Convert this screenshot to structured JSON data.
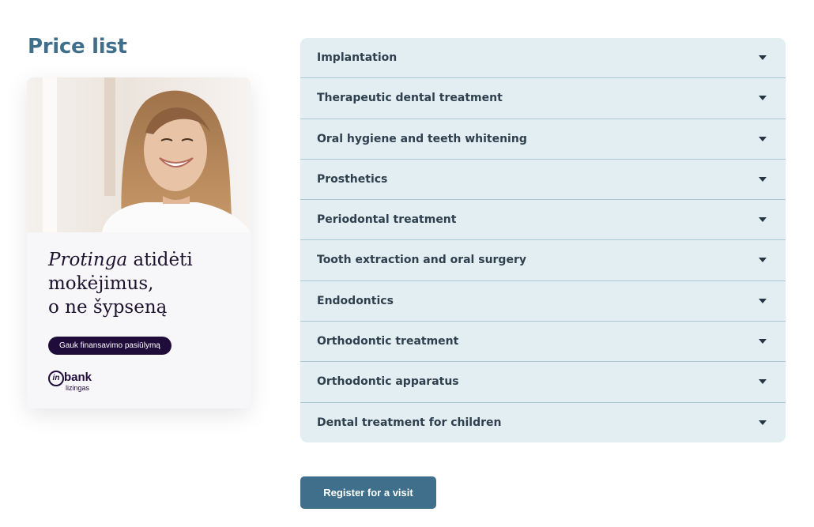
{
  "page": {
    "title": "Price list"
  },
  "promo": {
    "headline_em": "Protinga",
    "headline_rest_line1": " atidėti",
    "headline_line2": "mokėjimus,",
    "headline_line3": "o ne šypseną",
    "cta_label": "Gauk finansavimo pasiūlymą",
    "brand": {
      "mark": "in",
      "name": "bank",
      "sub": "lizingas"
    }
  },
  "accordion": {
    "items": [
      {
        "label": "Implantation",
        "icon": "caret-down-icon"
      },
      {
        "label": "Therapeutic dental treatment",
        "icon": "caret-down-icon"
      },
      {
        "label": "Oral hygiene and teeth whitening",
        "icon": "caret-down-icon"
      },
      {
        "label": "Prosthetics",
        "icon": "caret-down-icon"
      },
      {
        "label": "Periodontal treatment",
        "icon": "caret-down-icon"
      },
      {
        "label": "Tooth extraction and oral surgery",
        "icon": "caret-down-icon"
      },
      {
        "label": "Endodontics",
        "icon": "caret-down-icon"
      },
      {
        "label": "Orthodontic treatment",
        "icon": "caret-down-icon"
      },
      {
        "label": "Orthodontic apparatus",
        "icon": "caret-down-icon"
      },
      {
        "label": "Dental treatment for children",
        "icon": "caret-down-icon"
      }
    ]
  },
  "actions": {
    "register_label": "Register for a visit"
  },
  "colors": {
    "accent": "#3f6f8a",
    "accordion_bg": "#e3eef2",
    "accordion_divider": "#a9c8d4",
    "promo_dark": "#200c3a"
  }
}
